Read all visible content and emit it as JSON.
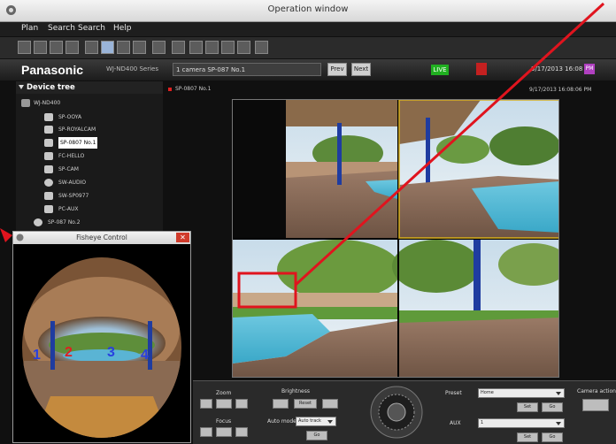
{
  "window": {
    "title": "Operation window"
  },
  "menu": {
    "items": [
      "Plan",
      "Search",
      "Search",
      "Help"
    ]
  },
  "brand": {
    "logo": "Panasonic",
    "series": "WJ-ND400 Series"
  },
  "camera_bar": {
    "selected": "1 camera SP-087 No.1",
    "btn_1": "Prev",
    "btn_2": "Next",
    "live": "LIVE",
    "datetime": "9/17/2013 16:08",
    "badge": "PM"
  },
  "device_tree": {
    "title": "Device tree",
    "items": [
      "WJ-ND400",
      "SP-OOYA",
      "SP-ROYALCAM",
      "SP-0807 No.1",
      "FC-HELLO",
      "SP-CAM",
      "SW-AUDIO",
      "SW-SP0977",
      "PC-AUX",
      "SP-087 No.2"
    ],
    "selected_index": 3
  },
  "viewer": {
    "header_left": "SP-0807 No.1",
    "header_right": "9/17/2013 16:08:06 PM"
  },
  "controls": {
    "zoom": "Zoom",
    "focus": "Focus",
    "brightness": "Brightness",
    "auto_mode": "Auto mode",
    "auto_mode_value": "Auto track",
    "preset": "Preset",
    "preset_value": "Home",
    "aux": "AUX",
    "aux_value": "1",
    "camera_action": "Camera action",
    "btn_set": "Set",
    "btn_go": "Go",
    "btn_reset": "Reset"
  },
  "popup": {
    "title": "Fisheye Control",
    "markers": [
      "1",
      "2",
      "3",
      "4"
    ]
  },
  "colors": {
    "annotation_red": "#e0141e",
    "marker_blue": "#2840e0",
    "marker_red": "#e02020"
  }
}
